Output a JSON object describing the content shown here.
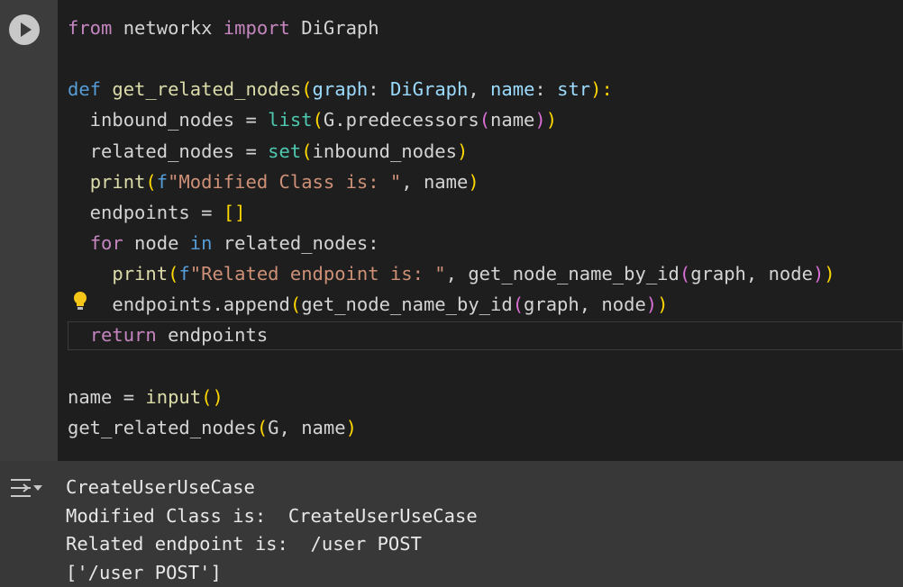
{
  "code": {
    "lines": [
      [
        "from",
        " networkx ",
        "import",
        " DiGraph"
      ],
      [
        ""
      ],
      [
        "def",
        " ",
        "get_related_nodes",
        "(",
        "graph",
        ": ",
        "DiGraph",
        ", ",
        "name",
        ": ",
        "str",
        "):"
      ],
      [
        "  inbound_nodes = ",
        "list",
        "(",
        "G.predecessors",
        "(",
        "name",
        ")",
        ")"
      ],
      [
        "  related_nodes = ",
        "set",
        "(",
        "inbound_nodes",
        ")"
      ],
      [
        "  ",
        "print",
        "(",
        "f",
        "\"Modified Class is: \"",
        ", name",
        ")"
      ],
      [
        "  endpoints = ",
        "[]"
      ],
      [
        "  ",
        "for",
        " node ",
        "in",
        " related_nodes:"
      ],
      [
        "    ",
        "print",
        "(",
        "f",
        "\"Related endpoint is: \"",
        ", get_node_name_by_id",
        "(",
        "graph, node",
        ")",
        ")"
      ],
      [
        "    endpoints.append",
        "(",
        "get_node_name_by_id",
        "(",
        "graph, node",
        ")",
        ")"
      ],
      [
        "  ",
        "return",
        " endpoints"
      ],
      [
        ""
      ],
      [
        "name = ",
        "input",
        "()"
      ],
      [
        "get_related_nodes",
        "(",
        "G, name",
        ")"
      ]
    ]
  },
  "output": {
    "lines": [
      "CreateUserUseCase",
      "Modified Class is:  CreateUserUseCase",
      "Related endpoint is:  /user POST",
      "['/user POST']"
    ]
  },
  "icons": {
    "run": "play-icon",
    "bulb": "lightbulb-icon",
    "output": "output-collapse-icon"
  }
}
